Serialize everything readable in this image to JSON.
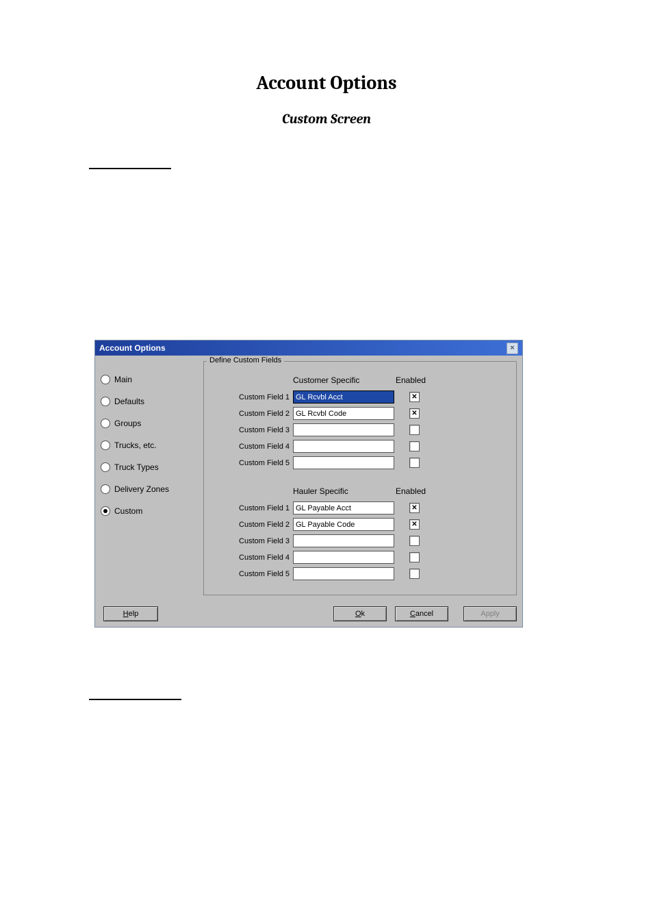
{
  "doc_title": "Account Options",
  "doc_subtitle": "Custom Screen",
  "dialog": {
    "title": "Account Options",
    "sidebar": {
      "items": [
        {
          "label": "Main",
          "selected": false
        },
        {
          "label": "Defaults",
          "selected": false
        },
        {
          "label": "Groups",
          "selected": false
        },
        {
          "label": "Trucks, etc.",
          "selected": false
        },
        {
          "label": "Truck Types",
          "selected": false
        },
        {
          "label": "Delivery Zones",
          "selected": false
        },
        {
          "label": "Custom",
          "selected": true
        }
      ]
    },
    "fieldset_legend": "Define Custom Fields",
    "sections": {
      "customer": {
        "header_specific": "Customer Specific",
        "header_enabled": "Enabled",
        "rows": [
          {
            "label": "Custom Field 1",
            "value": "GL Rcvbl Acct",
            "enabled": true,
            "active": true
          },
          {
            "label": "Custom Field 2",
            "value": "GL Rcvbl Code",
            "enabled": true,
            "active": false
          },
          {
            "label": "Custom Field 3",
            "value": "",
            "enabled": false,
            "active": false
          },
          {
            "label": "Custom Field 4",
            "value": "",
            "enabled": false,
            "active": false
          },
          {
            "label": "Custom Field 5",
            "value": "",
            "enabled": false,
            "active": false
          }
        ]
      },
      "hauler": {
        "header_specific": "Hauler Specific",
        "header_enabled": "Enabled",
        "rows": [
          {
            "label": "Custom Field 1",
            "value": "GL Payable Acct",
            "enabled": true,
            "active": false
          },
          {
            "label": "Custom Field 2",
            "value": "GL Payable Code",
            "enabled": true,
            "active": false
          },
          {
            "label": "Custom Field 3",
            "value": "",
            "enabled": false,
            "active": false
          },
          {
            "label": "Custom Field 4",
            "value": "",
            "enabled": false,
            "active": false
          },
          {
            "label": "Custom Field 5",
            "value": "",
            "enabled": false,
            "active": false
          }
        ]
      }
    },
    "buttons": {
      "help": "Help",
      "ok": "Ok",
      "cancel": "Cancel",
      "apply": "Apply"
    }
  }
}
